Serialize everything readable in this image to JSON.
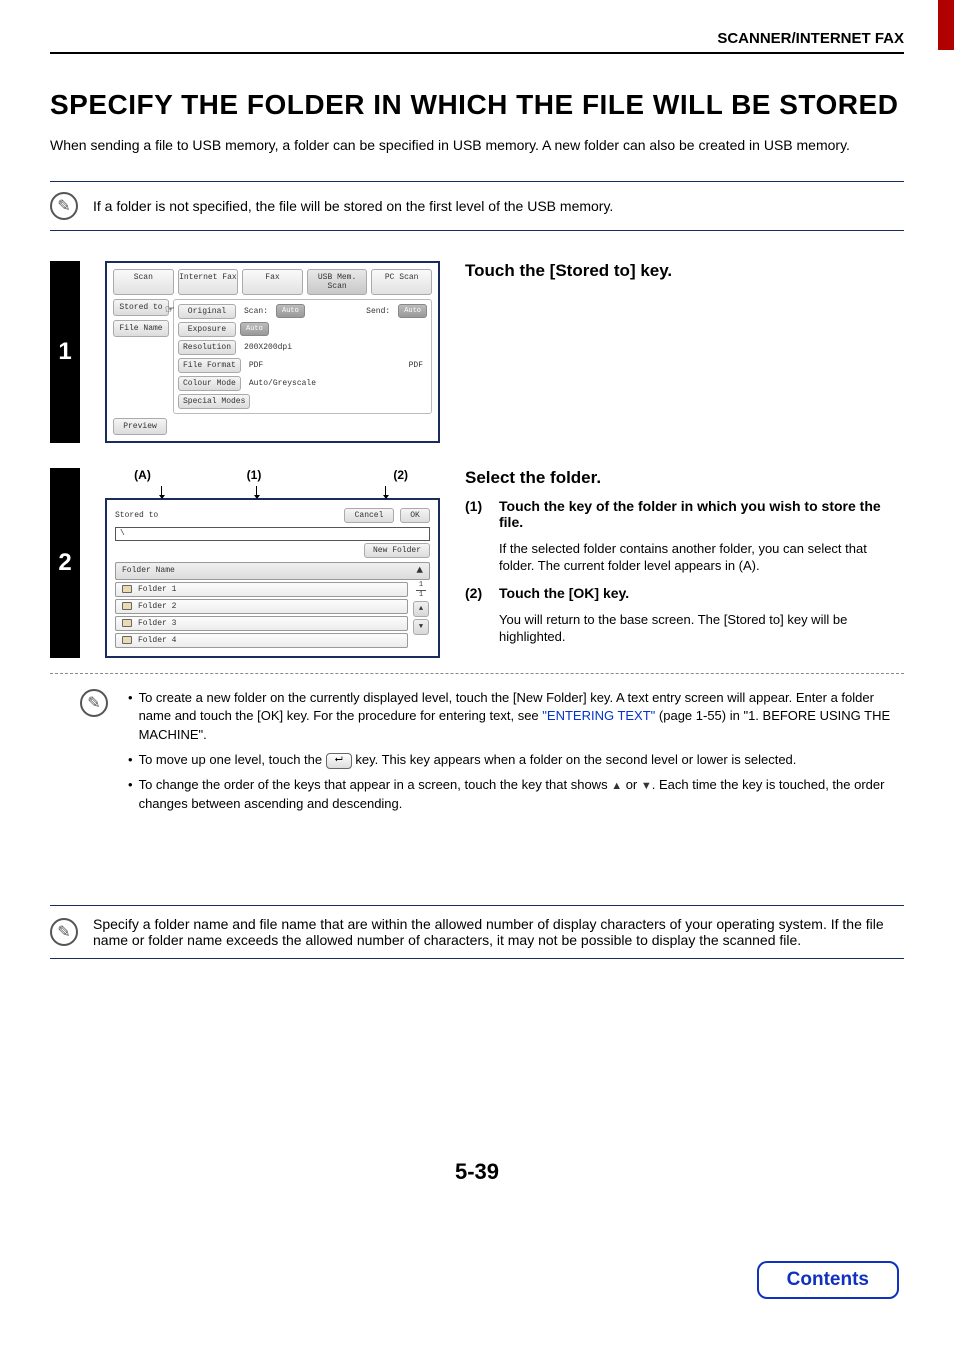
{
  "header": {
    "section": "SCANNER/INTERNET FAX"
  },
  "title": "SPECIFY THE FOLDER IN WHICH THE FILE WILL BE STORED",
  "intro": "When sending a file to USB memory, a folder can be specified in USB memory. A new folder can also be created in USB memory.",
  "note1": "If a folder is not specified, the file will be stored on the first level of the USB memory.",
  "step1": {
    "num": "1",
    "title": "Touch the [Stored to] key.",
    "ui": {
      "tabs": [
        "Scan",
        "Internet Fax",
        "Fax",
        "USB Mem. Scan",
        "PC Scan"
      ],
      "side": {
        "stored_to": "Stored to",
        "file_name": "File Name",
        "preview": "Preview"
      },
      "rows": {
        "original": "Original",
        "scan_lbl": "Scan:",
        "scan_val": "Auto",
        "send_lbl": "Send:",
        "send_val": "Auto",
        "exposure": "Exposure",
        "exposure_val": "Auto",
        "resolution": "Resolution",
        "resolution_val": "200X200dpi",
        "file_format": "File Format",
        "ff_val1": "PDF",
        "ff_val2": "PDF",
        "colour_mode": "Colour Mode",
        "cm_val": "Auto/Greyscale",
        "special_modes": "Special Modes"
      }
    }
  },
  "step2": {
    "num": "2",
    "title": "Select the folder.",
    "labels": {
      "a": "(A)",
      "one": "(1)",
      "two": "(2)"
    },
    "ui": {
      "title": "Stored to",
      "cancel": "Cancel",
      "ok": "OK",
      "new_folder": "New Folder",
      "path": "\\",
      "header": "Folder Name",
      "sort_glyph": "▲",
      "folders": [
        "Folder 1",
        "Folder 2",
        "Folder 3",
        "Folder 4"
      ],
      "page_cur": "1",
      "page_tot": "1",
      "up": "▲",
      "down": "▼"
    },
    "sub1_num": "(1)",
    "sub1_title": "Touch the key of the folder in which you wish to store the file.",
    "sub1_desc": "If the selected folder contains another folder, you can select that folder. The current folder level appears in (A).",
    "sub2_num": "(2)",
    "sub2_title": "Touch the [OK] key.",
    "sub2_desc": "You will return to the base screen. The [Stored to] key will be highlighted.",
    "tips": {
      "t1a": "To create a new folder on the currently displayed level, touch the [New Folder] key. A text entry screen will appear. Enter a folder name and touch the [OK] key. For the procedure for entering text, see ",
      "t1link": "\"ENTERING TEXT\"",
      "t1b": " (page 1-55) in \"1. BEFORE USING THE MACHINE\".",
      "t2a": "To move up one level, touch the ",
      "t2b": " key. This key appears when a folder on the second level or lower is selected.",
      "t3a": "To change the order of the keys that appear in a screen, touch the key that shows ",
      "t3b": " or ",
      "t3c": ". Each time the key is touched, the order changes between ascending and descending."
    }
  },
  "note2": "Specify a folder name and file name that are within the allowed number of display characters of your operating system. If the file name or folder name exceeds the allowed number of characters, it may not be possible to display the scanned file.",
  "page_number": "5-39",
  "contents_btn": "Contents",
  "glyphs": {
    "pencil": "✎",
    "hand": "☞",
    "up_key": "⮠",
    "tri_up": "▲",
    "tri_down": "▼"
  }
}
